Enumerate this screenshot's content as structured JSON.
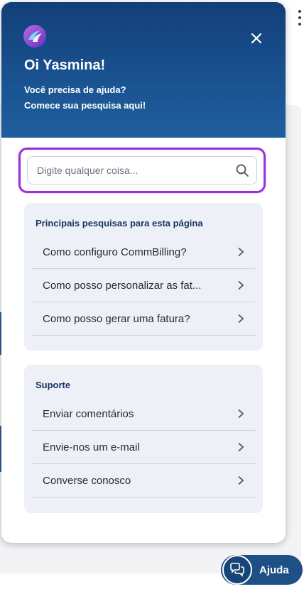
{
  "panel": {
    "greeting": "Oi Yasmina!",
    "subtitle_line1": "Você precisa de ajuda?",
    "subtitle_line2": "Comece sua pesquisa aqui!",
    "search": {
      "placeholder": "Digite qualquer coisa...",
      "value": ""
    },
    "top_searches": {
      "title": "Principais pesquisas para esta página",
      "items": [
        {
          "label": "Como configuro CommBilling?"
        },
        {
          "label": "Como posso personalizar as fat..."
        },
        {
          "label": "Como posso gerar uma fatura?"
        }
      ]
    },
    "support": {
      "title": "Suporte",
      "items": [
        {
          "label": "Enviar comentários"
        },
        {
          "label": "Envie-nos um e-mail"
        },
        {
          "label": "Converse conosco"
        }
      ]
    }
  },
  "help_button": {
    "label": "Ajuda"
  },
  "colors": {
    "header_top": "#123f78",
    "header_bottom": "#1f5e9e",
    "focus_ring": "#9b2fe0",
    "card_bg": "#eef0f8",
    "card_title": "#17335f"
  }
}
